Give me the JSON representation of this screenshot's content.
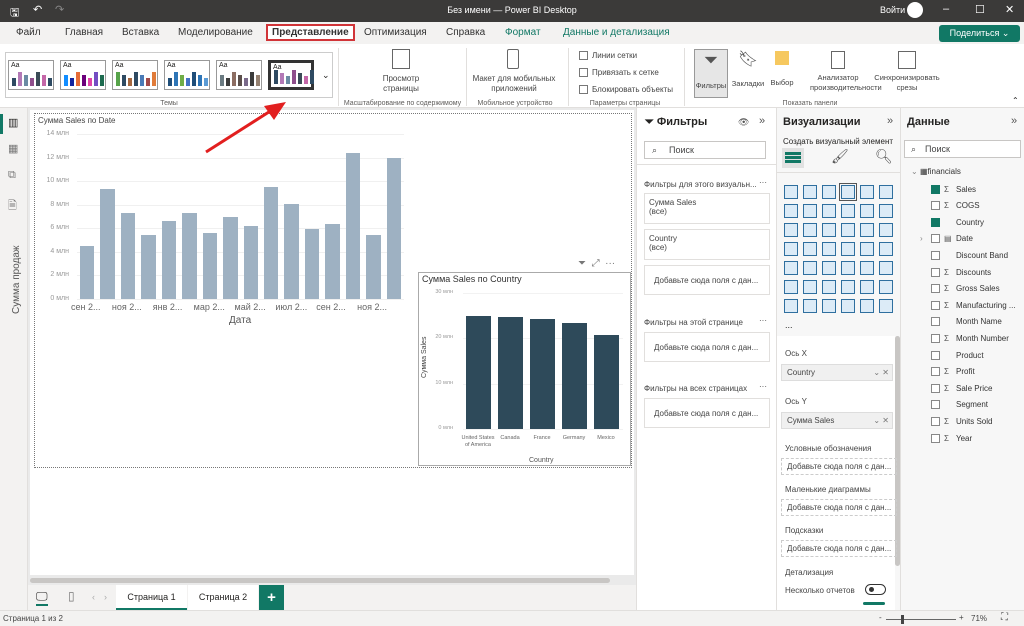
{
  "window": {
    "title": "Без имени — Power BI Desktop",
    "signin": "Войти"
  },
  "tabs": [
    "Файл",
    "Главная",
    "Вставка",
    "Моделирование",
    "Представление",
    "Оптимизация",
    "Справка",
    "Формат",
    "Данные и детализация"
  ],
  "share": "Поделиться",
  "ribbon": {
    "themes_label": "Темы",
    "themes": [
      [
        "#2e4a62",
        "#b379b6",
        "#6b8ba3",
        "#8f4e8c",
        "#3b4b57",
        "#c467a8",
        "#2e4a62"
      ],
      [
        "#118dff",
        "#12239e",
        "#e66c37",
        "#6b007b",
        "#e044a7",
        "#744ec2",
        "#1d6b4f"
      ],
      [
        "#57a34a",
        "#2e4a62",
        "#a5673f",
        "#2e4a62",
        "#4a7bb7",
        "#a34a4a",
        "#e07b39"
      ],
      [
        "#1f4e79",
        "#2e75b6",
        "#70ad47",
        "#4472c4",
        "#1f4e79",
        "#2e75b6",
        "#5b9bd5"
      ],
      [
        "#6b7b82",
        "#3b3b3b",
        "#8c6d62",
        "#5b4f4b",
        "#7a6a8a",
        "#3b3b3b",
        "#958171"
      ],
      [
        "#2e4a62",
        "#b379b6",
        "#6b8ba3",
        "#8f4e8c",
        "#3b4b57",
        "#c467a8",
        "#2e4a62"
      ]
    ],
    "page_view": "Просмотр страницы",
    "scale_group": "Масштабирование по содержимому",
    "mobile": "Макет для мобильных приложений",
    "mobile_group": "Мобильное устройство",
    "checks": [
      {
        "label": "Линии сетки",
        "checked": false
      },
      {
        "label": "Привязать к сетке",
        "checked": false
      },
      {
        "label": "Блокировать объекты",
        "checked": false
      }
    ],
    "page_group": "Параметры страницы",
    "panes": [
      "Фильтры",
      "Закладки",
      "Выбор",
      "Анализатор производительности",
      "Синхронизировать срезы"
    ],
    "panes_group": "Показать панели"
  },
  "chart_data": [
    {
      "type": "bar",
      "title": "Сумма Sales по Date",
      "xlabel": "Дата",
      "ylabel": "Сумма продаж",
      "ylim": [
        0,
        14
      ],
      "yticks": [
        "0 млн",
        "2 млн",
        "4 млн",
        "6 млн",
        "8 млн",
        "10 млн",
        "12 млн",
        "14 млн"
      ],
      "xticks": [
        "сен 2...",
        "ноя 2...",
        "янв 2...",
        "мар 2...",
        "май 2...",
        "июл 2...",
        "сен 2...",
        "ноя 2..."
      ],
      "values": [
        4.5,
        9.3,
        7.3,
        5.4,
        6.6,
        7.3,
        5.6,
        7.0,
        6.2,
        9.5,
        8.1,
        5.9,
        6.4,
        12.4,
        5.4,
        12.0
      ],
      "unit": "млн",
      "color": "#9eb1c2"
    },
    {
      "type": "bar",
      "title": "Сумма Sales по Country",
      "xlabel": "Country",
      "ylabel": "Сумма Sales",
      "ylim": [
        0,
        30
      ],
      "yticks": [
        "0 млн",
        "10 млн",
        "20 млн",
        "30 млн"
      ],
      "categories": [
        "United States of America",
        "Canada",
        "France",
        "Germany",
        "Mexico"
      ],
      "values": [
        24.9,
        24.8,
        24.3,
        23.4,
        20.8
      ],
      "unit": "млн",
      "color": "#2e4a5a"
    }
  ],
  "filters": {
    "title": "Фильтры",
    "search": "Поиск",
    "visual_section": "Фильтры для этого визуальн...",
    "cards": [
      {
        "name": "Сумма Sales",
        "value": "(все)"
      },
      {
        "name": "Country",
        "value": "(все)"
      }
    ],
    "add": "Добавьте сюда поля с дан...",
    "page_section": "Фильтры на этой странице",
    "all_section": "Фильтры на всех страницах"
  },
  "viz": {
    "title": "Визуализации",
    "build": "Создать визуальный элемент",
    "icons": [
      "stacked-bar",
      "stacked-column",
      "clustered-bar",
      "clustered-column",
      "100-bar",
      "100-column",
      "line",
      "area",
      "stacked-area",
      "line-column",
      "ribbon",
      "waterfall-a",
      "line-stacked",
      "waterfall",
      "funnel",
      "scatter",
      "pie",
      "donut",
      "treemap",
      "map",
      "filled-map",
      "azure-map",
      "gauge",
      "card",
      "multi-card",
      "kpi",
      "slicer",
      "table",
      "matrix",
      "r-visual",
      "python",
      "key-influencers",
      "decomposition",
      "qa",
      "narrative",
      "trophy",
      "paginated",
      "power-apps",
      "power-automate",
      "metrics",
      "diamond",
      "chevrons"
    ],
    "more": "...",
    "x_axis": "Ось X",
    "x_field": "Country",
    "y_axis": "Ось Y",
    "y_field": "Сумма Sales",
    "legend": "Условные обозначения",
    "small": "Маленькие диаграммы",
    "tooltips": "Подсказки",
    "add": "Добавьте сюда поля с дан...",
    "drill": "Детализация",
    "cross": "Несколько отчетов",
    "cross_on": false
  },
  "data": {
    "title": "Данные",
    "search": "Поиск",
    "table": "financials",
    "fields": [
      {
        "n": "Sales",
        "s": true,
        "c": true
      },
      {
        "n": "COGS",
        "s": true,
        "c": false
      },
      {
        "n": "Country",
        "s": false,
        "c": true
      },
      {
        "n": "Date",
        "s": false,
        "c": false,
        "d": true
      },
      {
        "n": "Discount Band",
        "s": false,
        "c": false
      },
      {
        "n": "Discounts",
        "s": true,
        "c": false
      },
      {
        "n": "Gross Sales",
        "s": true,
        "c": false
      },
      {
        "n": "Manufacturing ...",
        "s": true,
        "c": false
      },
      {
        "n": "Month Name",
        "s": false,
        "c": false
      },
      {
        "n": "Month Number",
        "s": true,
        "c": false
      },
      {
        "n": "Product",
        "s": false,
        "c": false
      },
      {
        "n": "Profit",
        "s": true,
        "c": false
      },
      {
        "n": "Sale Price",
        "s": true,
        "c": false
      },
      {
        "n": "Segment",
        "s": false,
        "c": false
      },
      {
        "n": "Units Sold",
        "s": true,
        "c": false
      },
      {
        "n": "Year",
        "s": true,
        "c": false
      }
    ]
  },
  "pages": [
    "Страница 1",
    "Страница 2"
  ],
  "status": {
    "page": "Страница 1 из 2",
    "zoom": "71%",
    "zoom_level": 71
  }
}
